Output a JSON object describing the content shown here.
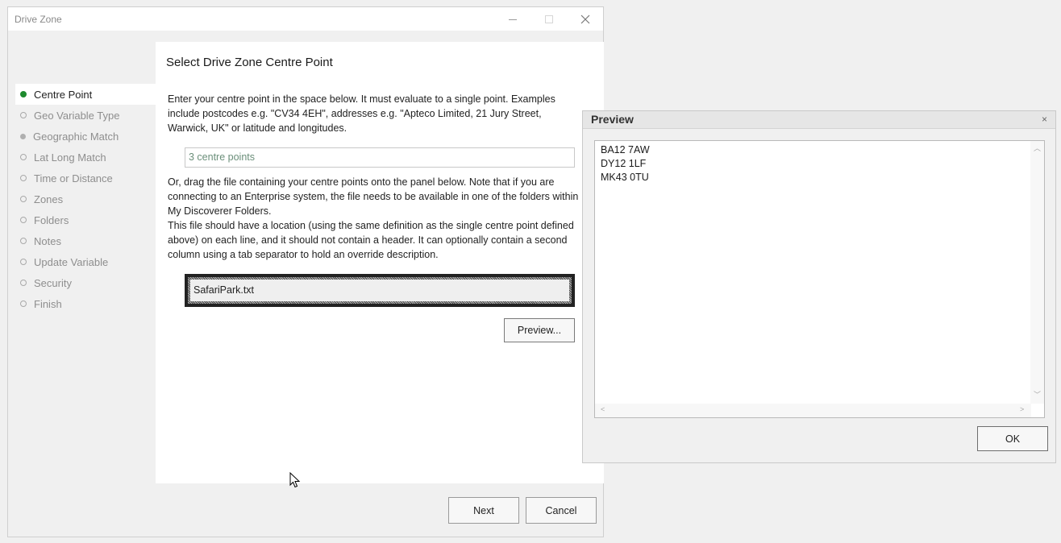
{
  "window": {
    "title": "Drive Zone",
    "minimize_icon": "minimize-icon",
    "maximize_icon": "maximize-icon",
    "close_icon": "close-icon"
  },
  "sidebar": {
    "items": [
      {
        "label": "Centre Point",
        "state": "active"
      },
      {
        "label": "Geo Variable Type",
        "state": "pending"
      },
      {
        "label": "Geographic Match",
        "state": "disabled"
      },
      {
        "label": "Lat Long Match",
        "state": "pending"
      },
      {
        "label": "Time or Distance",
        "state": "pending"
      },
      {
        "label": "Zones",
        "state": "pending"
      },
      {
        "label": "Folders",
        "state": "pending"
      },
      {
        "label": "Notes",
        "state": "pending"
      },
      {
        "label": "Update Variable",
        "state": "pending"
      },
      {
        "label": "Security",
        "state": "pending"
      },
      {
        "label": "Finish",
        "state": "pending"
      }
    ],
    "active_color": "#1e8a2e"
  },
  "main": {
    "heading": "Select Drive Zone Centre Point",
    "intro_text": "Enter your centre point in the space below.  It must evaluate to a single point.  Examples include postcodes e.g. \"CV34 4EH\", addresses e.g. \"Apteco Limited, 21 Jury Street, Warwick, UK\" or latitude and longitudes.",
    "centre_point_value": "3 centre points",
    "drag_text": "Or, drag the file containing your centre points onto the panel below. Note that if you are connecting to an Enterprise system, the file needs to be available in one of the folders within My Discoverer Folders.",
    "file_text": "This file should have a location (using the same definition as the single centre point defined above) on each line, and it should not contain a header.  It can optionally contain a second column using a tab separator to hold an override description.",
    "file_name": "SafariPark.txt",
    "preview_button": "Preview..."
  },
  "footer": {
    "next_label": "Next",
    "cancel_label": "Cancel"
  },
  "preview_dialog": {
    "title": "Preview",
    "close_label": "×",
    "lines": [
      "BA12 7AW",
      "DY12 1LF",
      "MK43 0TU"
    ],
    "ok_label": "OK"
  }
}
